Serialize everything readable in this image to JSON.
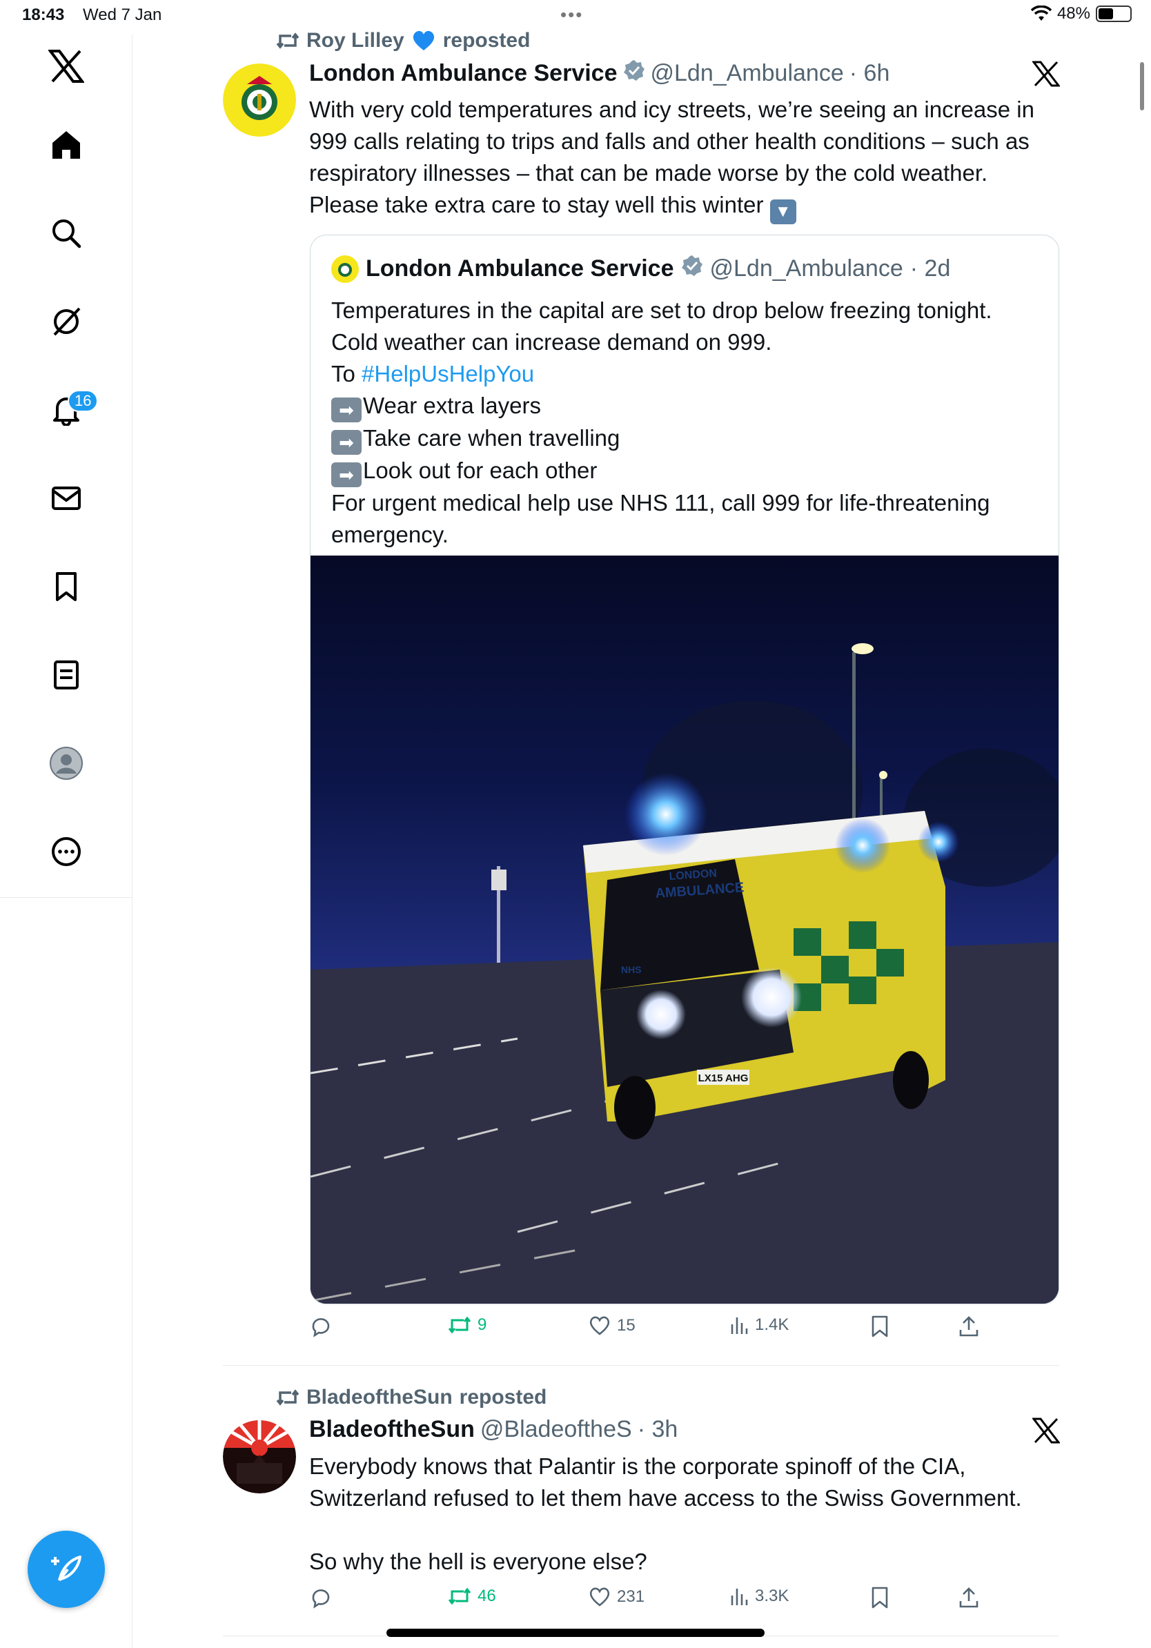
{
  "status_bar": {
    "time": "18:43",
    "date": "Wed 7 Jan",
    "battery": "48%",
    "battery_level": 0.48
  },
  "nav": {
    "notification_count": "16",
    "items": [
      "x-logo-icon",
      "home-icon",
      "search-icon",
      "grok-icon",
      "notifications-icon",
      "messages-icon",
      "bookmarks-icon",
      "lists-icon",
      "profile-icon",
      "more-icon"
    ]
  },
  "colors": {
    "accent": "#1d9bf0",
    "retweet": "#00ba7c",
    "muted": "#536471"
  },
  "tweets": [
    {
      "repost_by": "Roy Lilley",
      "repost_suffix": "reposted",
      "name": "London Ambulance Service",
      "handle": "@Ldn_Ambulance",
      "time": "· 6h",
      "text": "With very cold temperatures and icy streets, we’re seeing an increase in 999 calls relating to trips and falls and other health conditions – such as respiratory illnesses – that can be made worse by the cold weather. Please take extra care to stay well this winter",
      "quote": {
        "name": "London Ambulance Service",
        "handle": "@Ldn_Ambulance",
        "time": "· 2d",
        "line1": "Temperatures in the capital are set to drop below freezing tonight.",
        "line2": "Cold weather can increase demand on 999.",
        "line3_prefix": "To ",
        "hashtag": "#HelpUsHelpYou",
        "bullet1": "Wear extra layers",
        "bullet2": "Take care when travelling",
        "bullet3": "Look out for each other",
        "line_last": "For urgent medical help use NHS 111, call 999 for life-threatening emergency.",
        "photo": {
          "van_top": "LONDON",
          "van_bottom": "AMBULANCE",
          "plate": "LX15 AHG",
          "nhs": "NHS"
        }
      },
      "stats": {
        "retweets": "9",
        "likes": "15",
        "views": "1.4K"
      }
    },
    {
      "repost_by": "BladeoftheSun",
      "repost_suffix": "reposted",
      "name": "BladeoftheSun",
      "handle": "@BladeoftheS",
      "time": "· 3h",
      "text": "Everybody knows that Palantir is the corporate spinoff of the CIA, Switzerland refused to let them have access to the Swiss Government.\n\nSo why the hell is everyone else?",
      "stats": {
        "retweets": "46",
        "likes": "231",
        "views": "3.3K"
      }
    }
  ]
}
